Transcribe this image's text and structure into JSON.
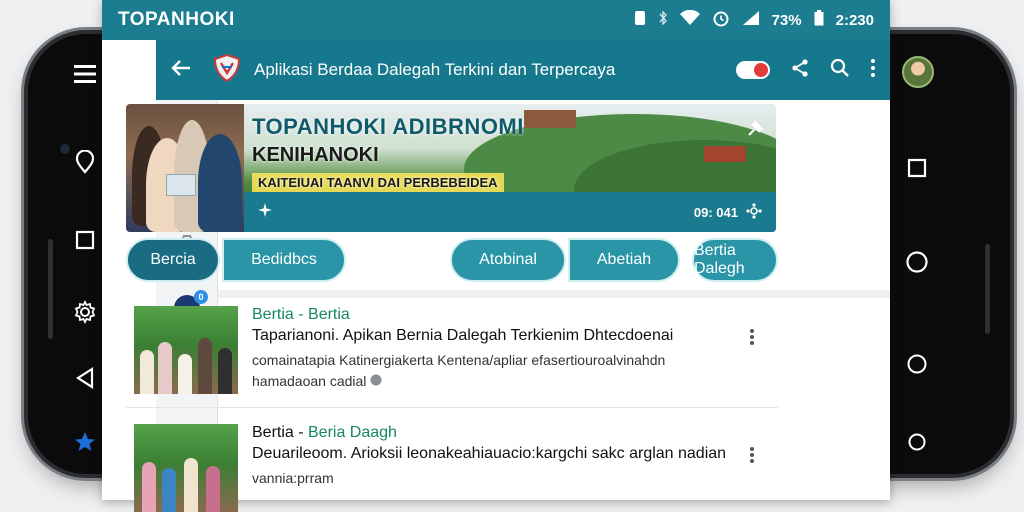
{
  "status_bar": {
    "brand": "TOPANHOKI",
    "battery": "73%",
    "time": "2:230"
  },
  "app_bar": {
    "title": "Aplikasi Berdaa Dalegah Terkini dan Terpercaya"
  },
  "banner": {
    "headline": "TOPANHOKI ADIBRNOMI",
    "subheadline": "KENIHANOKI",
    "tagline": "KAITEIUAI TAANVI DAI PERBEBEIDEA",
    "strip_info": "09: 041"
  },
  "chips": [
    {
      "label": "Bercia",
      "active": true
    },
    {
      "label": "Bedidbcs",
      "active": false
    },
    {
      "label": "Atobinal",
      "active": false
    },
    {
      "label": "Abetiah",
      "active": false
    },
    {
      "label": "Bertia Dalegh",
      "active": false
    }
  ],
  "news": [
    {
      "category": "Bertia - Bertia",
      "title": "Taparianoni. Apikan Bernia Dalegah Terkienim Dhtecdoenai",
      "desc_line1": "comainatapia Katinergiakerta Kentena/apliar efasertiouroalvinahdn",
      "desc_line2": "hamadaoan cadial"
    },
    {
      "category_prefix": "Bertia - ",
      "category": "Beria Daagh",
      "title": "Deuarileoom. Arioksii leonakeahiauacio:kargchi sakc arglan nadian",
      "desc_line1": "vannia:prram",
      "desc_line2": ""
    }
  ],
  "colors": {
    "primary": "#16788c",
    "status": "#1c7d91",
    "chip": "#2a95a6",
    "accent_green": "#18885f"
  }
}
